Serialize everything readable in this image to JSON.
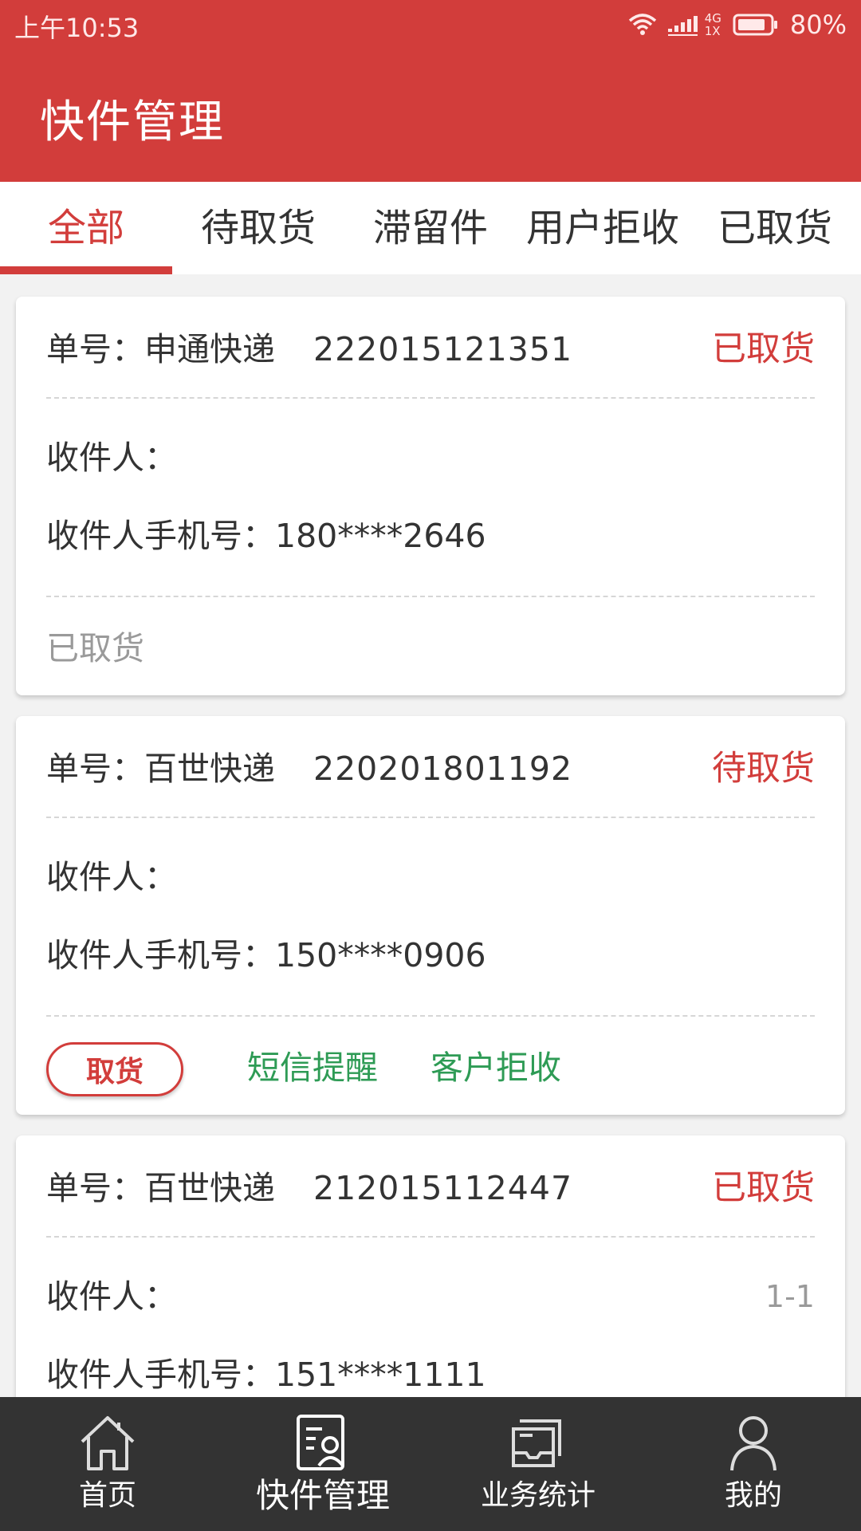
{
  "status_bar": {
    "time": "上午10:53",
    "network_top": "4G",
    "network_bottom": "1X",
    "battery": "80%"
  },
  "header": {
    "title": "快件管理"
  },
  "tabs": [
    {
      "label": "全部",
      "active": true
    },
    {
      "label": "待取货",
      "active": false
    },
    {
      "label": "滞留件",
      "active": false
    },
    {
      "label": "用户拒收",
      "active": false
    },
    {
      "label": "已取货",
      "active": false
    }
  ],
  "cards": [
    {
      "order_label": "单号：申通快递",
      "order_number": "222015121351",
      "status": "已取货",
      "recipient_label": "收件人：",
      "phone": "收件人手机号：180****2646",
      "footer_status": "已取货"
    },
    {
      "order_label": "单号：百世快递",
      "order_number": "220201801192",
      "status": "待取货",
      "recipient_label": "收件人：",
      "phone": "收件人手机号：150****0906",
      "actions": {
        "pickup": "取货",
        "sms": "短信提醒",
        "reject": "客户拒收"
      }
    },
    {
      "order_label": "单号：百世快递",
      "order_number": "212015112447",
      "status": "已取货",
      "recipient_label": "收件人：",
      "phone": "收件人手机号：151****1111",
      "page_indicator": "1-1"
    }
  ],
  "bottom_nav": [
    {
      "label": "首页",
      "icon": "home-icon"
    },
    {
      "label": "快件管理",
      "icon": "package-manage-icon",
      "active": true
    },
    {
      "label": "业务统计",
      "icon": "stats-icon"
    },
    {
      "label": "我的",
      "icon": "user-icon"
    }
  ],
  "colors": {
    "brand_red": "#d23d3b",
    "action_green": "#2e9b55",
    "nav_bg": "#333333"
  }
}
